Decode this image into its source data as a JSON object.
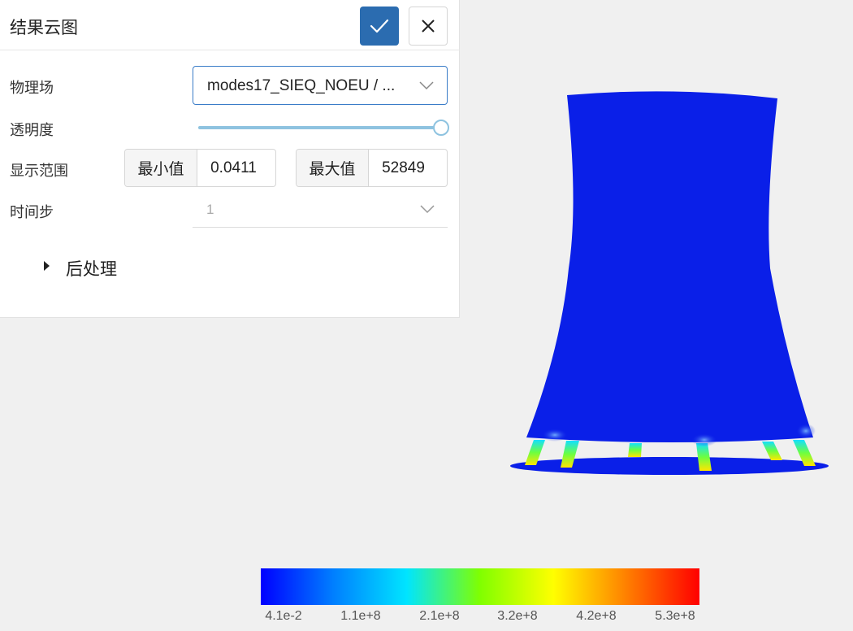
{
  "panel": {
    "title": "结果云图",
    "ok_icon": "check-icon",
    "close_icon": "close-icon",
    "field_label": "物理场",
    "field_value": "modes17_SIEQ_NOEU / ...",
    "opacity_label": "透明度",
    "opacity_value": 1.0,
    "range_label": "显示范围",
    "min_label": "最小值",
    "min_value": "0.0411",
    "max_label": "最大值",
    "max_value": "52849",
    "timestep_label": "时间步",
    "timestep_value": "1",
    "postprocess_label": "后处理"
  },
  "colorbar": {
    "colors": [
      "#0000ff",
      "#0080ff",
      "#00e5ff",
      "#80ff00",
      "#ffff00",
      "#ff8000",
      "#ff0000"
    ],
    "tick_labels": [
      "4.1e-2",
      "1.1e+8",
      "2.1e+8",
      "3.2e+8",
      "4.2e+8",
      "5.3e+8"
    ]
  },
  "model": {
    "body_color": "#0a1fe8",
    "base_color": "#0a1fe8"
  }
}
